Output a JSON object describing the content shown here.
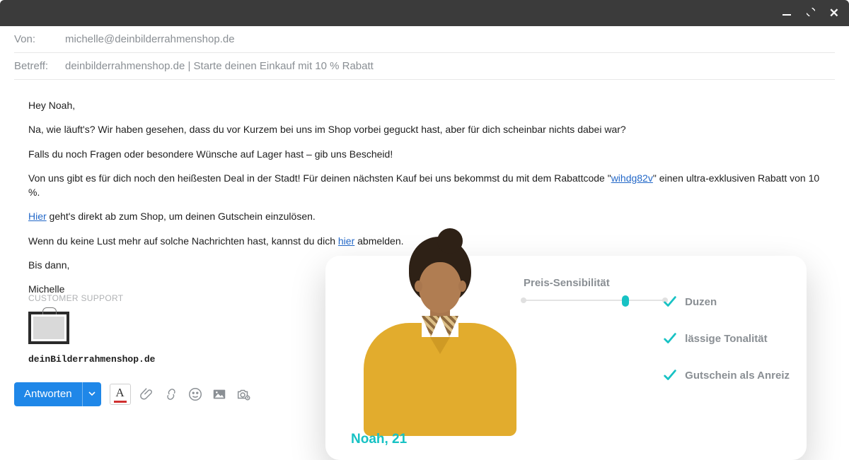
{
  "window": {
    "minimize_title": "Minimieren",
    "maximize_title": "Maximieren",
    "close_title": "Schließen"
  },
  "meta": {
    "from_label": "Von:",
    "from_value": "michelle@deinbilderrahmenshop.de",
    "subject_label": "Betreff:",
    "subject_value": "deinbilderrahmenshop.de | Starte deinen Einkauf mit 10 % Rabatt"
  },
  "body": {
    "greeting": "Hey Noah,",
    "p1": "Na, wie läuft's? Wir haben gesehen, dass du vor Kurzem bei uns im Shop vorbei geguckt hast, aber für dich scheinbar nichts dabei war?",
    "p2": "Falls du noch Fragen oder besondere Wünsche auf Lager hast – gib uns Bescheid!",
    "p3_pre": "Von uns gibt es für dich noch  den heißesten Deal in der Stadt! Für deinen nächsten Kauf bei uns bekommst du mit dem Rabattcode  \"",
    "coupon": "wihdg82v",
    "p3_post": "\" einen ultra-exklusiven Rabatt von 10 %.",
    "p4_link": "Hier",
    "p4_post": " geht's direkt ab zum Shop, um deinen Gutschein einzulösen.",
    "p5_pre": "Wenn du keine Lust mehr auf solche Nachrichten hast, kannst du dich ",
    "p5_link": "hier",
    "p5_post": " abmelden.",
    "bye": "Bis dann,",
    "sig_name": "Michelle",
    "sig_role": "CUSTOMER SUPPORT",
    "shop_name": "deinBilderrahmenshop.de"
  },
  "toolbar": {
    "reply": "Antworten"
  },
  "persona": {
    "name": "Noah, 21",
    "sensitivity_label": "Preis-Sensibilität",
    "sensitivity_pct": 72,
    "checks": [
      "Duzen",
      "lässige Tonalität",
      "Gutschein als Anreiz"
    ]
  }
}
